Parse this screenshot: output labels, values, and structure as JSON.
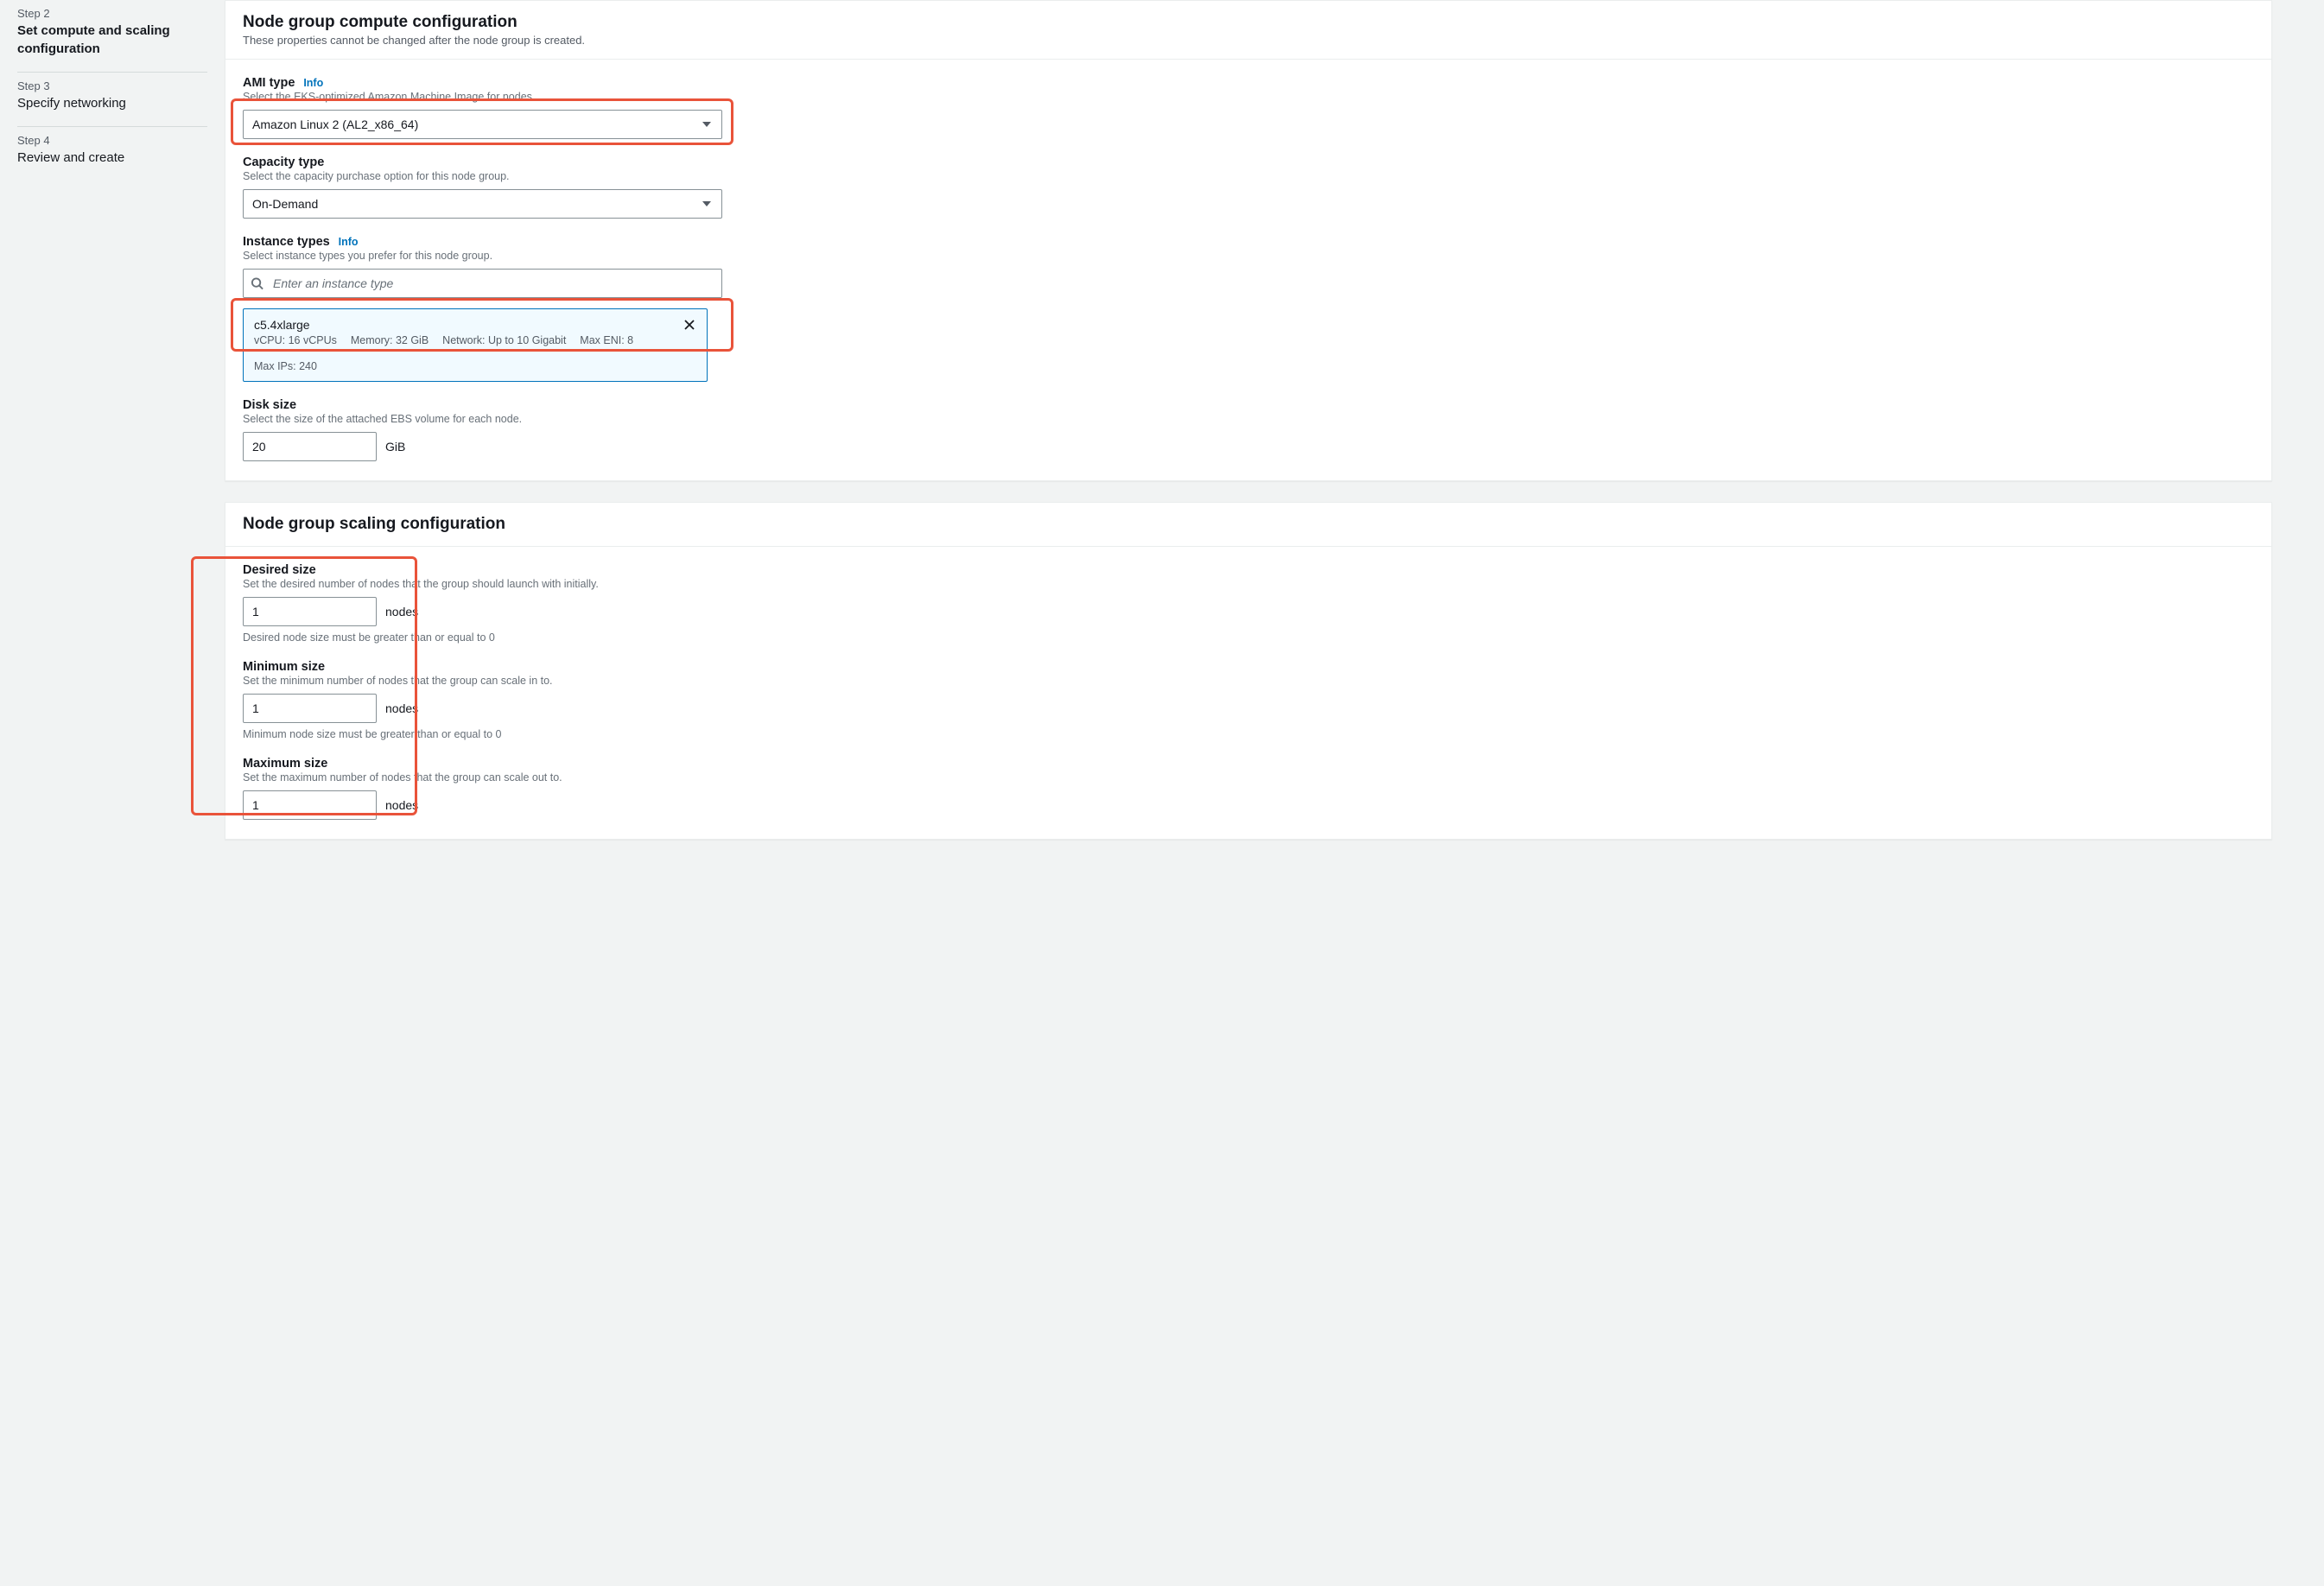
{
  "sidebar": {
    "steps": [
      {
        "num": "Step 2",
        "title": "Set compute and scaling configuration",
        "active": true
      },
      {
        "num": "Step 3",
        "title": "Specify networking",
        "active": false
      },
      {
        "num": "Step 4",
        "title": "Review and create",
        "active": false
      }
    ]
  },
  "compute_panel": {
    "title": "Node group compute configuration",
    "subtitle": "These properties cannot be changed after the node group is created.",
    "ami": {
      "label": "AMI type",
      "info": "Info",
      "desc": "Select the EKS-optimized Amazon Machine Image for nodes.",
      "value": "Amazon Linux 2 (AL2_x86_64)"
    },
    "capacity": {
      "label": "Capacity type",
      "desc": "Select the capacity purchase option for this node group.",
      "value": "On-Demand"
    },
    "instance_types": {
      "label": "Instance types",
      "info": "Info",
      "desc": "Select instance types you prefer for this node group.",
      "placeholder": "Enter an instance type",
      "selected": {
        "name": "c5.4xlarge",
        "vcpu": "vCPU: 16 vCPUs",
        "memory": "Memory: 32 GiB",
        "network": "Network: Up to 10 Gigabit",
        "max_eni": "Max ENI: 8",
        "max_ips": "Max IPs: 240"
      }
    },
    "disk": {
      "label": "Disk size",
      "desc": "Select the size of the attached EBS volume for each node.",
      "value": "20",
      "unit": "GiB"
    }
  },
  "scaling_panel": {
    "title": "Node group scaling configuration",
    "desired": {
      "label": "Desired size",
      "desc": "Set the desired number of nodes that the group should launch with initially.",
      "value": "1",
      "unit": "nodes",
      "hint": "Desired node size must be greater than or equal to 0"
    },
    "minimum": {
      "label": "Minimum size",
      "desc": "Set the minimum number of nodes that the group can scale in to.",
      "value": "1",
      "unit": "nodes",
      "hint": "Minimum node size must be greater than or equal to 0"
    },
    "maximum": {
      "label": "Maximum size",
      "desc": "Set the maximum number of nodes that the group can scale out to.",
      "value": "1",
      "unit": "nodes"
    }
  }
}
